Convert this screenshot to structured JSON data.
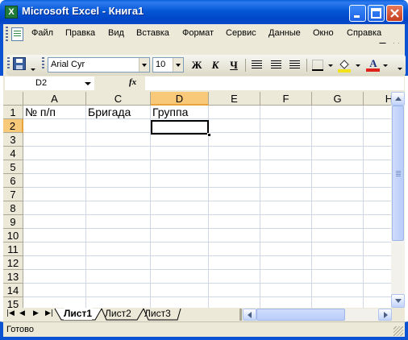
{
  "window": {
    "title": "Microsoft Excel - Книга1",
    "app_icon_letter": "X"
  },
  "menu": {
    "items": [
      "Файл",
      "Правка",
      "Вид",
      "Вставка",
      "Формат",
      "Сервис",
      "Данные",
      "Окно",
      "Справка"
    ]
  },
  "toolbar": {
    "font_name": "Arial Cyr",
    "font_size": "10",
    "bold_label": "Ж",
    "italic_label": "К",
    "underline_label": "Ч",
    "font_color_label": "A",
    "fill_color": "#f2e21a",
    "font_color": "#e0201a"
  },
  "formula_bar": {
    "name_box": "D2",
    "fx_label": "fx",
    "content": ""
  },
  "grid": {
    "columns": [
      "A",
      "C",
      "D",
      "E",
      "F",
      "G",
      "H"
    ],
    "selected_column": "D",
    "rows": [
      "1",
      "2",
      "3",
      "4",
      "5",
      "6",
      "7",
      "8",
      "9",
      "10",
      "11",
      "12",
      "13",
      "14",
      "15"
    ],
    "selected_row": "2",
    "cells": {
      "A1": "№ п/п",
      "C1": "Бригада",
      "D1": "Группа"
    },
    "active_cell": "D2"
  },
  "sheets": {
    "tabs": [
      "Лист1",
      "Лист2",
      "Лист3"
    ],
    "active": "Лист1"
  },
  "status": {
    "text": "Готово"
  },
  "colors": {
    "title_bar": "#0557d5",
    "selection_header": "#f9c97a",
    "chrome": "#ece9d8"
  }
}
